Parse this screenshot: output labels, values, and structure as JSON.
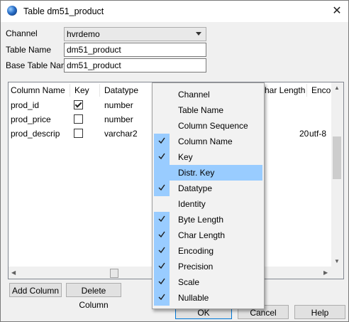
{
  "window": {
    "title": "Table dm51_product",
    "close_glyph": "✕"
  },
  "form": {
    "channel_label": "Channel",
    "channel_value": "hvrdemo",
    "table_name_label": "Table Name",
    "table_name_value": "dm51_product",
    "base_table_name_label": "Base Table Name",
    "base_table_name_value": "dm51_product"
  },
  "grid": {
    "headers": {
      "column_name": "Column Name",
      "key": "Key",
      "datatype": "Datatype",
      "char_length": "har Length",
      "encoding": "Encoc"
    },
    "rows": [
      {
        "name": "prod_id",
        "key": true,
        "datatype": "number",
        "char_length": "",
        "encoding": ""
      },
      {
        "name": "prod_price",
        "key": false,
        "datatype": "number",
        "char_length": "",
        "encoding": ""
      },
      {
        "name": "prod_descrip",
        "key": false,
        "datatype": "varchar2",
        "char_length": "20",
        "encoding": "utf-8"
      }
    ]
  },
  "buttons": {
    "add_column": "Add Column",
    "delete_column": "Delete Column",
    "ok": "OK",
    "cancel": "Cancel",
    "help": "Help"
  },
  "context_menu": {
    "items": [
      {
        "label": "Channel",
        "checked": false,
        "highlighted": false
      },
      {
        "label": "Table Name",
        "checked": false,
        "highlighted": false
      },
      {
        "label": "Column Sequence",
        "checked": false,
        "highlighted": false
      },
      {
        "label": "Column Name",
        "checked": true,
        "highlighted": false
      },
      {
        "label": "Key",
        "checked": true,
        "highlighted": false
      },
      {
        "label": "Distr. Key",
        "checked": false,
        "highlighted": true
      },
      {
        "label": "Datatype",
        "checked": true,
        "highlighted": false
      },
      {
        "label": "Identity",
        "checked": false,
        "highlighted": false
      },
      {
        "label": "Byte Length",
        "checked": true,
        "highlighted": false
      },
      {
        "label": "Char Length",
        "checked": true,
        "highlighted": false
      },
      {
        "label": "Encoding",
        "checked": true,
        "highlighted": false
      },
      {
        "label": "Precision",
        "checked": true,
        "highlighted": false
      },
      {
        "label": "Scale",
        "checked": true,
        "highlighted": false
      },
      {
        "label": "Nullable",
        "checked": true,
        "highlighted": false
      }
    ]
  },
  "colors": {
    "highlight": "#99ccff",
    "focus_border": "#0078d7"
  },
  "icons": {
    "app": "globe-icon",
    "close": "close-icon",
    "check": "check-icon",
    "combo": "chevron-down-icon"
  }
}
